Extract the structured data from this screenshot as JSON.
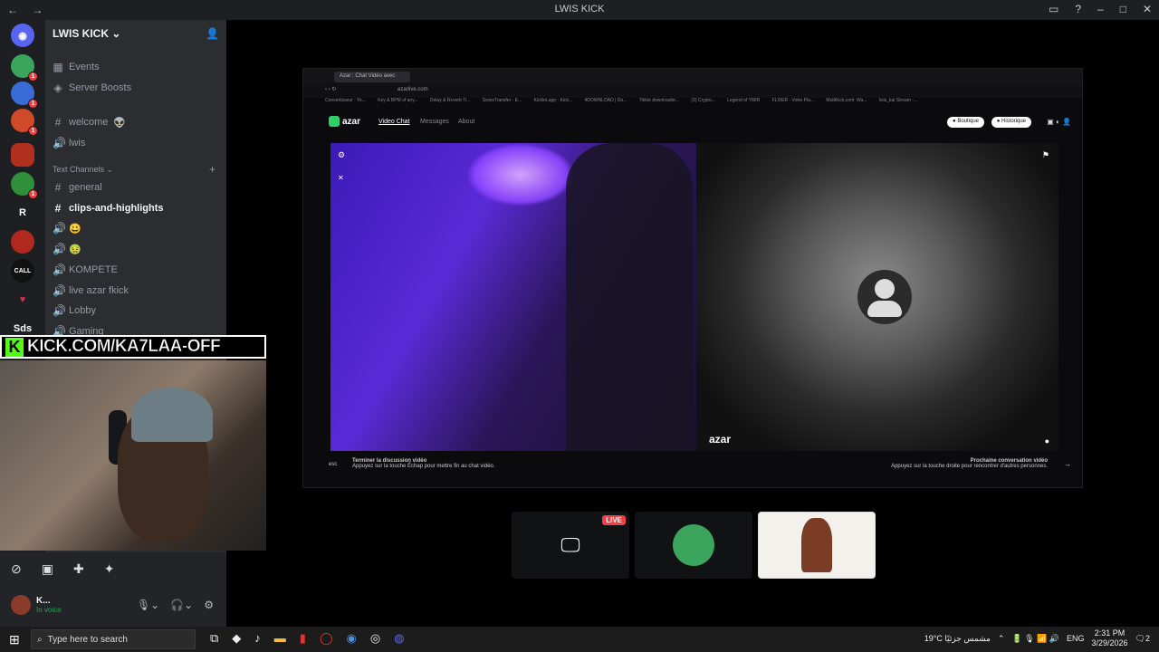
{
  "window": {
    "title": "LWIS KICK",
    "nav": "← →"
  },
  "server": {
    "name": "LWIS KICK"
  },
  "server_list": [
    {
      "label": "",
      "color": "#3ba55d",
      "badge": "1"
    },
    {
      "label": "",
      "color": "#3a6bd6",
      "badge": "1"
    },
    {
      "label": "",
      "color": "#d04a2a",
      "badge": "1"
    },
    {
      "label": "",
      "color": "#b03020",
      "badge": ""
    },
    {
      "label": "",
      "color": "#2f8f3a",
      "badge": "1"
    },
    {
      "label": "R",
      "color": "#1e1f22",
      "badge": ""
    },
    {
      "label": "",
      "color": "#b0281e",
      "badge": ""
    },
    {
      "label": "CALL",
      "color": "#111",
      "badge": ""
    },
    {
      "label": "♥",
      "color": "#1e1f22",
      "badge": ""
    },
    {
      "label": "Sds",
      "color": "#1e1f22",
      "badge": ""
    }
  ],
  "channels": {
    "events": "Events",
    "boosts": "Server Boosts",
    "welcome": "welcome",
    "lwis": "lwis",
    "text_category": "Text Channels",
    "general": "general",
    "clips": "clips-and-highlights",
    "emoji1": "😀",
    "emoji2": "🤢",
    "kompete": "KOMPETE",
    "live": "live azar fkick",
    "lobby": "Lobby",
    "gaming": "Gaming"
  },
  "overlay": {
    "kick_badge": "K",
    "kick_text": "KICK.COM/KA7LAA-OFF"
  },
  "browser": {
    "tab_title": "Azar : Chat Vidéo avec",
    "url": "azarlive.com",
    "bookmarks": [
      "Convertisseur : Yo...",
      "Key & BPM of any...",
      "Delay & Reverb Ti...",
      "SwissTransfer - E...",
      "Kicklet.app - Kick...",
      "4DOWNLOAD | Do...",
      "Tiktok downloader...",
      "(3) Crypto...",
      "Legend of YMIR",
      "FLIXER - Votre Pla...",
      "MultiKick.com: Wa...",
      "lwis_kai Stream -..."
    ],
    "azar_logo": "azar",
    "nav": [
      "Video Chat",
      "Messages",
      "About"
    ],
    "boutique": "Boutique",
    "historique": "Historique",
    "watermark": "azar",
    "footer_left_title": "Terminer la discussion vidéo",
    "footer_left_sub": "Appuyez sur la touche Échap pour mettre fin au chat vidéo.",
    "footer_esc": "esc",
    "footer_right_title": "Prochaine conversation vidéo",
    "footer_right_sub": "Appuyez sur la touche droite pour rencontrer d'autres personnes."
  },
  "tiles": {
    "live_badge": "LIVE"
  },
  "user": {
    "name": "K...",
    "status": "In voice"
  },
  "taskbar": {
    "search_placeholder": "Type here to search",
    "weather": "19°C  مشمس جزئيًا",
    "lang": "ENG",
    "time": "2:31 PM",
    "date": "3/29/2026",
    "notif": "2"
  }
}
